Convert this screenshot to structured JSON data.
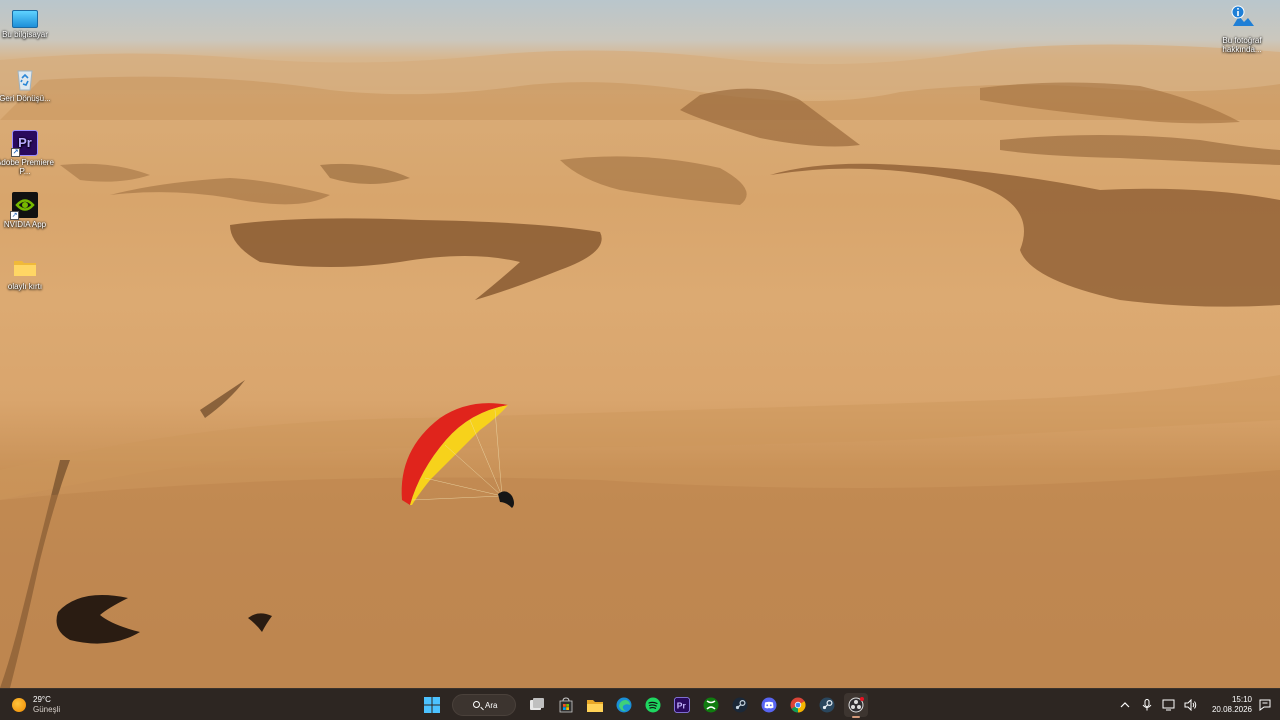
{
  "desktop": {
    "icons": [
      {
        "label": "Bu bilgisayar",
        "icon": "computer-icon"
      },
      {
        "label": "Geri Dönüşü...",
        "icon": "recycle-bin-icon"
      },
      {
        "label": "Adobe Premiere P...",
        "icon": "premiere-pro-icon"
      },
      {
        "label": "NVIDIA App",
        "icon": "nvidia-icon"
      },
      {
        "label": "olaylı kırtı",
        "icon": "folder-icon"
      }
    ],
    "photo_info": {
      "label": "Bu fotoğraf hakkında...",
      "icon": "info-icon"
    }
  },
  "taskbar": {
    "weather": {
      "temp": "29°C",
      "condition": "Güneşli",
      "icon": "sun-icon"
    },
    "search": {
      "label": "Ara",
      "icon": "search-icon"
    },
    "pinned": [
      "start-icon",
      "task-view-icon",
      "store-icon",
      "file-explorer-icon",
      "edge-icon",
      "spotify-icon",
      "premiere-pro-icon",
      "xbox-icon",
      "steam-icon",
      "discord-icon",
      "chrome-icon",
      "steam-icon",
      "obs-icon"
    ],
    "tray": {
      "icons": [
        "chevron-up-icon",
        "microphone-icon",
        "network-icon",
        "volume-icon"
      ],
      "time": "15:10",
      "date": "20.08.2026",
      "notification_icon": "bell-icon"
    }
  },
  "colors": {
    "taskbar": "#2d2622",
    "sand": "#d9a56d",
    "wing_red": "#e0241c",
    "wing_yellow": "#f7d21b"
  }
}
